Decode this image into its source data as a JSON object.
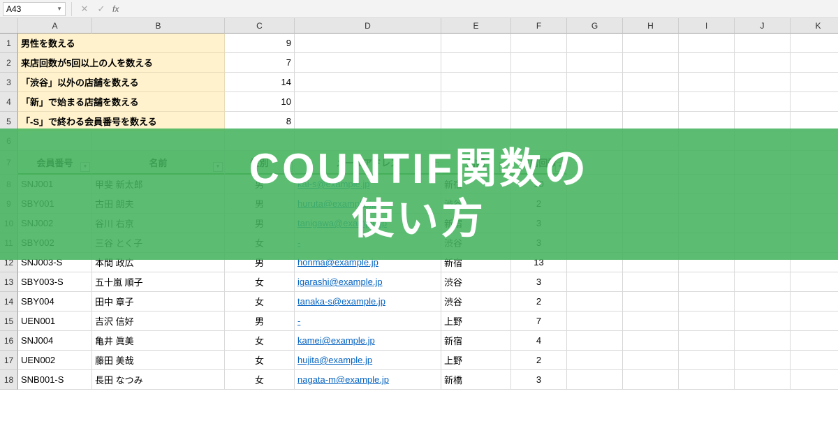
{
  "formula_bar": {
    "name_box": "A43",
    "fx": "fx"
  },
  "columns": [
    "A",
    "B",
    "C",
    "D",
    "E",
    "F",
    "G",
    "H",
    "I",
    "J",
    "K"
  ],
  "summary": [
    {
      "label": "男性を数える",
      "value": "9"
    },
    {
      "label": "来店回数が5回以上の人を数える",
      "value": "7"
    },
    {
      "label": "「渋谷」以外の店舗を数える",
      "value": "14"
    },
    {
      "label": "「新」で始まる店舗を数える",
      "value": "10"
    },
    {
      "label": "「-S」で終わる会員番号を数える",
      "value": "8"
    }
  ],
  "table_headers": [
    "会員番号",
    "名前",
    "性別",
    "メールアドレス",
    "店舗",
    "来店回数"
  ],
  "rows": [
    {
      "n": "8",
      "id": "SNJ001",
      "name": "甲斐 新太郎",
      "sex": "男",
      "mail": "kai-s@example.jp",
      "store": "新宿",
      "visit": "10"
    },
    {
      "n": "9",
      "id": "SBY001",
      "name": "古田 朗夫",
      "sex": "男",
      "mail": "huruta@example.jp",
      "store": "渋谷",
      "visit": "2"
    },
    {
      "n": "10",
      "id": "SNJ002",
      "name": "谷川 右京",
      "sex": "男",
      "mail": "tanigawa@example.jp",
      "store": "新宿",
      "visit": "3"
    },
    {
      "n": "11",
      "id": "SBY002",
      "name": "三谷 とく子",
      "sex": "女",
      "mail": "-",
      "store": "渋谷",
      "visit": "3"
    },
    {
      "n": "12",
      "id": "SNJ003-S",
      "name": "本間 政広",
      "sex": "男",
      "mail": "honma@example.jp",
      "store": "新宿",
      "visit": "13"
    },
    {
      "n": "13",
      "id": "SBY003-S",
      "name": "五十嵐 順子",
      "sex": "女",
      "mail": "igarashi@example.jp",
      "store": "渋谷",
      "visit": "3"
    },
    {
      "n": "14",
      "id": "SBY004",
      "name": "田中 章子",
      "sex": "女",
      "mail": "tanaka-s@example.jp",
      "store": "渋谷",
      "visit": "2"
    },
    {
      "n": "15",
      "id": "UEN001",
      "name": "吉沢 信好",
      "sex": "男",
      "mail": "-",
      "store": "上野",
      "visit": "7"
    },
    {
      "n": "16",
      "id": "SNJ004",
      "name": "亀井 眞美",
      "sex": "女",
      "mail": "kamei@example.jp",
      "store": "新宿",
      "visit": "4"
    },
    {
      "n": "17",
      "id": "UEN002",
      "name": "藤田 美哉",
      "sex": "女",
      "mail": "hujita@example.jp",
      "store": "上野",
      "visit": "2"
    },
    {
      "n": "18",
      "id": "SNB001-S",
      "name": "長田 なつみ",
      "sex": "女",
      "mail": "nagata-m@example.jp",
      "store": "新橋",
      "visit": "3"
    }
  ],
  "overlay": {
    "line1": "COUNTIF関数の",
    "line2": "使い方"
  }
}
